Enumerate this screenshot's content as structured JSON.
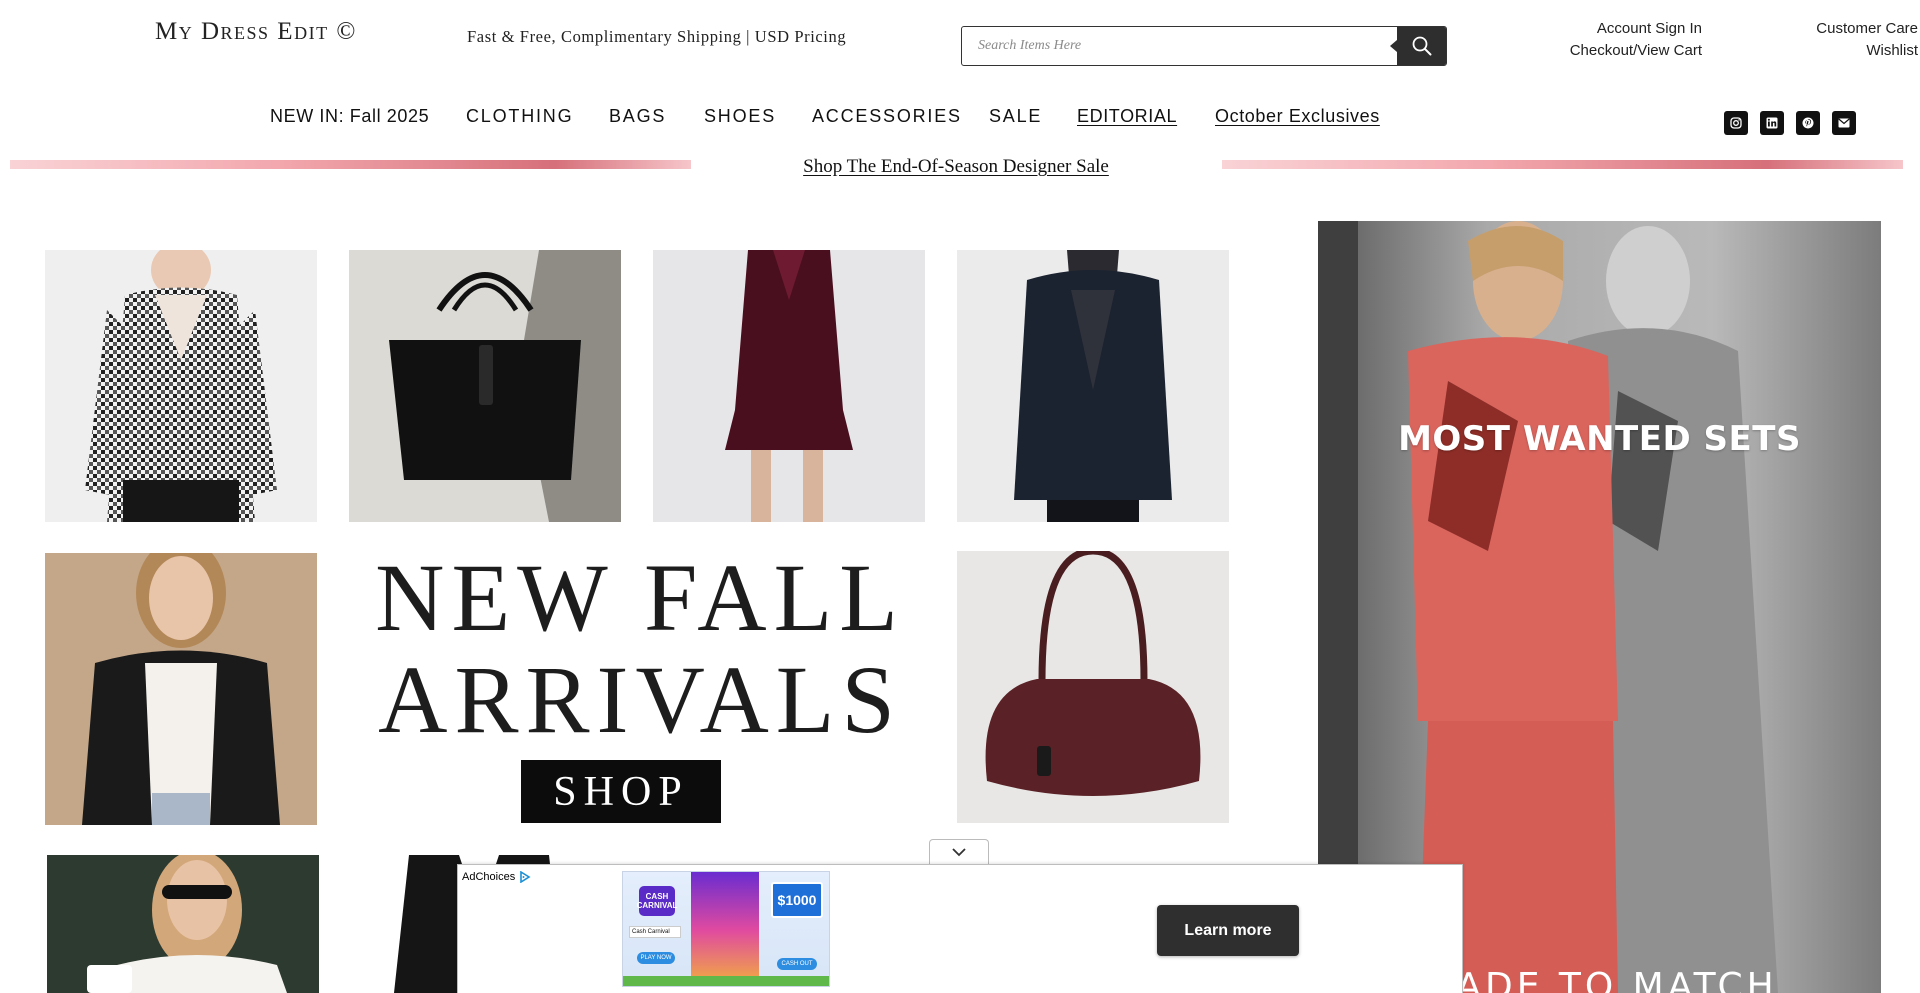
{
  "header": {
    "logo": "My Dress Edit ©",
    "shipping": "Fast & Free, Complimentary Shipping | USD Pricing",
    "search_placeholder": "Search Items Here",
    "account_sign_in": "Account Sign In",
    "checkout": "Checkout/View Cart",
    "customer_care": "Customer Care",
    "wishlist": "Wishlist"
  },
  "nav": {
    "items": [
      "NEW IN: Fall 2025",
      "CLOTHING",
      "BAGS",
      "SHOES",
      "ACCESSORIES",
      "SALE",
      "EDITORIAL",
      "October Exclusives"
    ]
  },
  "social": {
    "icons": [
      "instagram-icon",
      "linkedin-icon",
      "pinterest-icon",
      "email-icon"
    ]
  },
  "banner": {
    "sale_link": "Shop The End-Of-Season Designer Sale"
  },
  "promo": {
    "line1": "NEW FALL",
    "line2": "ARRIVALS",
    "shop": "SHOP"
  },
  "hero": {
    "title": "MOST WANTED SETS",
    "subtitle": "MADE TO MATCH"
  },
  "ad": {
    "adchoices": "AdChoices",
    "brand": "CASH CARNIVAL",
    "search_label": "Cash Carnival",
    "amount": "$1000",
    "cta_small_1": "PLAY NOW",
    "cta_small_2": "CASH OUT",
    "learn_more": "Learn more"
  },
  "colors": {
    "accent_pink": "#e58a93",
    "search_button": "#2e2e2e",
    "hero_suit": "#d9655d"
  }
}
